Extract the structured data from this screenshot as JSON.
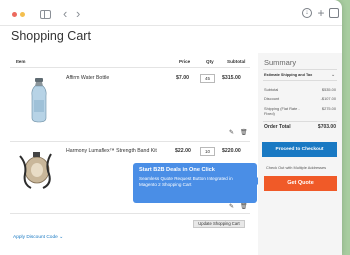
{
  "page": {
    "title": "Shopping Cart"
  },
  "browser": {
    "back": "‹",
    "forward": "›",
    "icons": [
      "sidebar-icon",
      "download-icon",
      "new-tab-icon",
      "tabs-icon"
    ]
  },
  "table": {
    "headers": {
      "item": "Item",
      "price": "Price",
      "qty": "Qty",
      "subtotal": "Subtotal"
    },
    "rows": [
      {
        "name": "Affirm Water Bottle",
        "price": "$7.00",
        "qty": "45",
        "subtotal": "$315.00"
      },
      {
        "name": "Harmony Lumaflex™ Strength Band Kit",
        "price": "$22.00",
        "qty": "10",
        "subtotal": "$220.00"
      }
    ]
  },
  "tooltip": {
    "title": "Start B2B Deals in One Click",
    "body": "Seamless Quote Request Button Integrated in Magento 2 Shopping Cart"
  },
  "actions": {
    "update_cart": "Update Shopping Cart",
    "apply_discount": "Apply Discount Code"
  },
  "summary": {
    "title": "Summary",
    "estimate": "Estimate Shipping and Tax",
    "subtotal_label": "Subtotal",
    "subtotal_value": "$535.00",
    "discount_label": "Discount",
    "discount_value": "-$107.00",
    "shipping_label": "Shipping (Flat Rate - Fixed)",
    "shipping_value": "$275.00",
    "total_label": "Order Total",
    "total_value": "$703.00",
    "checkout": "Proceed to Checkout",
    "multi": "Check Out with Multiple Addresses",
    "quote": "Get Quote"
  },
  "colors": {
    "accent_blue": "#1979c3",
    "quote_orange": "#f05a28",
    "tooltip_blue": "#4a8ee6",
    "background_green": "#a8cda0"
  }
}
